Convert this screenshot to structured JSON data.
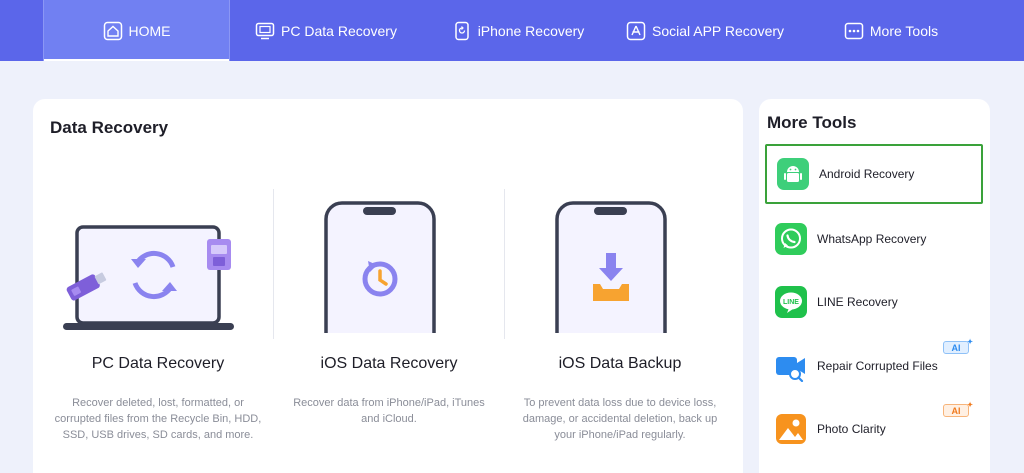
{
  "nav": {
    "items": [
      {
        "label": "HOME",
        "icon": "home-icon"
      },
      {
        "label": "PC Data Recovery",
        "icon": "monitor-icon"
      },
      {
        "label": "iPhone Recovery",
        "icon": "phone-restore-icon"
      },
      {
        "label": "Social APP Recovery",
        "icon": "app-store-icon"
      },
      {
        "label": "More Tools",
        "icon": "more-dots-icon"
      }
    ]
  },
  "main": {
    "title": "Data Recovery",
    "tiles": [
      {
        "title": "PC Data Recovery",
        "desc": "Recover deleted, lost, formatted, or corrupted files from the Recycle Bin, HDD, SSD, USB drives, SD cards, and more."
      },
      {
        "title": "iOS Data Recovery",
        "desc": "Recover data from iPhone/iPad, iTunes and iCloud."
      },
      {
        "title": "iOS Data Backup",
        "desc": "To prevent data loss due to device loss, damage, or accidental deletion, back up your iPhone/iPad regularly."
      }
    ]
  },
  "side": {
    "title": "More Tools",
    "tools": [
      {
        "label": "Android Recovery",
        "icon": "android-icon",
        "color": "#3ecf7a",
        "selected": true
      },
      {
        "label": "WhatsApp Recovery",
        "icon": "whatsapp-icon",
        "color": "#2fcc5b"
      },
      {
        "label": "LINE Recovery",
        "icon": "line-icon",
        "color": "#1fc14b"
      },
      {
        "label": "Repair Corrupted Files",
        "icon": "video-repair-icon",
        "color": "#2d8cf0",
        "badge": "AI"
      },
      {
        "label": "Photo Clarity",
        "icon": "photo-icon",
        "color": "#f7931e",
        "badge": "AI"
      }
    ]
  },
  "colors": {
    "nav_bg": "#5b66ea",
    "nav_active": "#7180f2",
    "accent": "#6b63e8",
    "selected_border": "#3aa23a"
  }
}
